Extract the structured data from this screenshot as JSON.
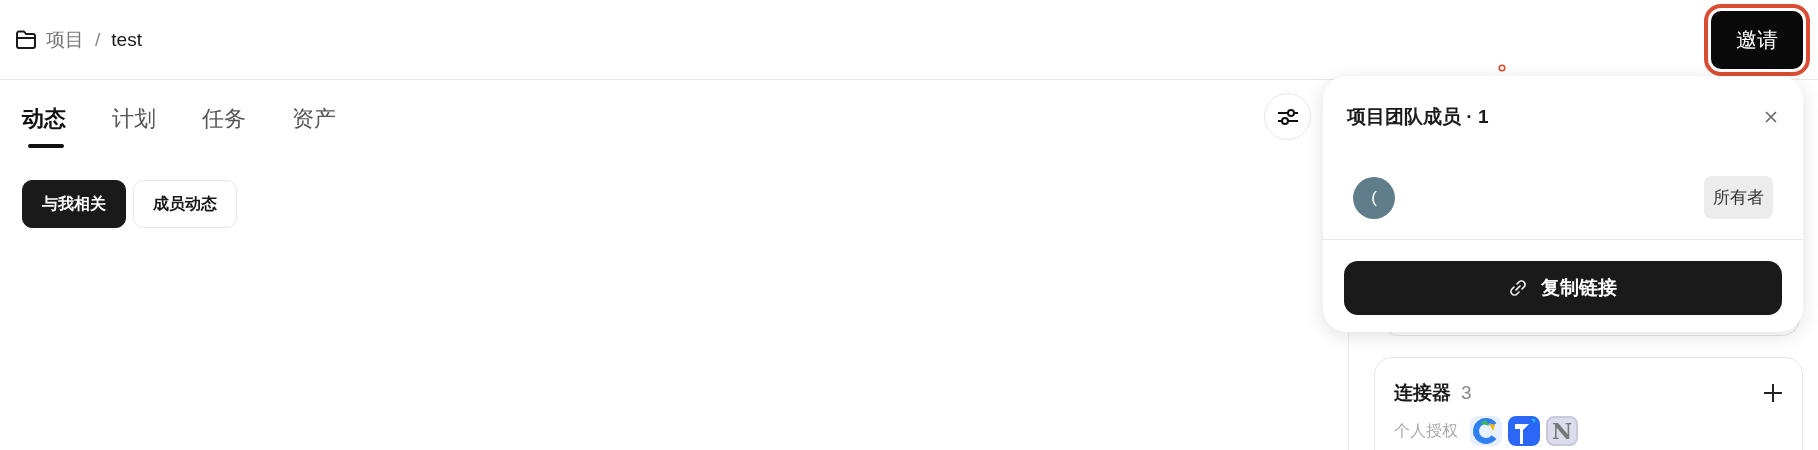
{
  "breadcrumb": {
    "parent": "项目",
    "separator": "/",
    "current": "test"
  },
  "invite_button": "邀请",
  "tabs": [
    {
      "label": "动态",
      "selected": true
    },
    {
      "label": "计划",
      "selected": false
    },
    {
      "label": "任务",
      "selected": false
    },
    {
      "label": "资产",
      "selected": false
    }
  ],
  "filters": [
    {
      "label": "与我相关",
      "selected": true
    },
    {
      "label": "成员动态",
      "selected": false
    }
  ],
  "popover": {
    "title": "项目团队成员 · 1",
    "members": [
      {
        "avatar": "(",
        "color": "#607d8b",
        "role": "所有者"
      }
    ],
    "copy_button": "复制链接"
  },
  "connectors": {
    "title": "连接器",
    "count": "3",
    "authorization_label": "个人授权",
    "apps": [
      {
        "kind": "ring"
      },
      {
        "kind": "arrow"
      },
      {
        "kind": "letter",
        "text": "N"
      }
    ]
  }
}
